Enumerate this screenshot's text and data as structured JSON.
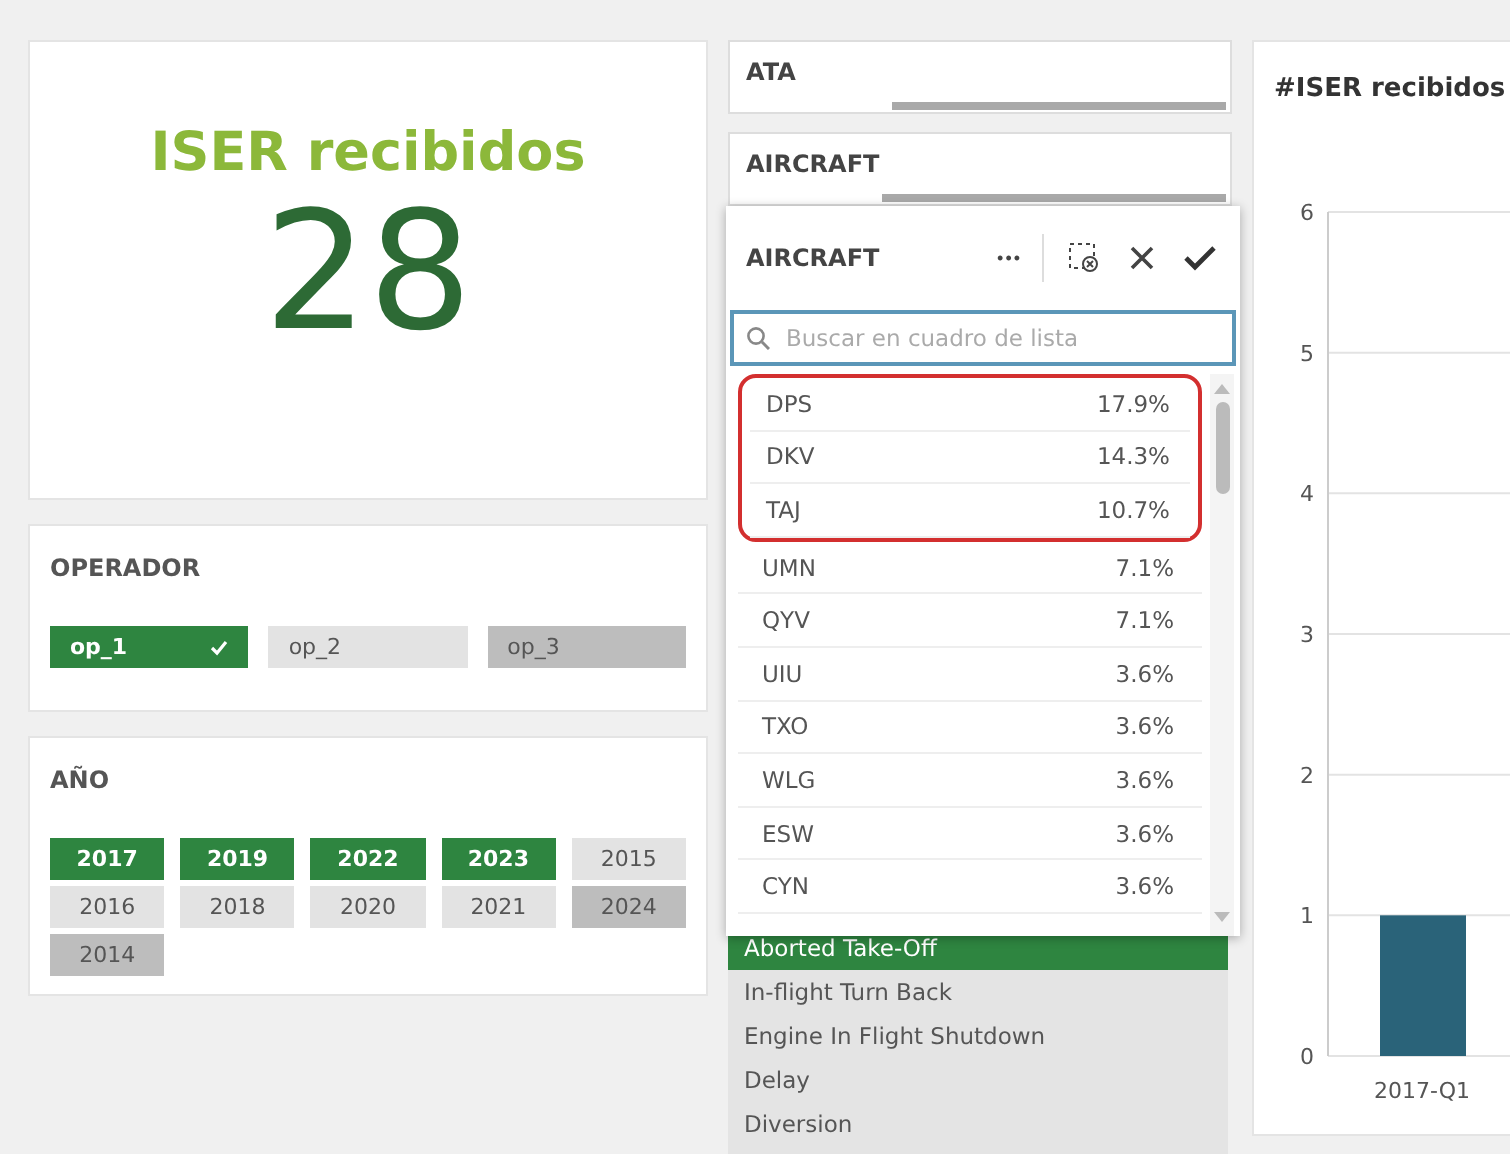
{
  "kpi": {
    "title": "ISER recibidos",
    "value": "28"
  },
  "operador": {
    "title": "OPERADOR",
    "items": [
      {
        "label": "op_1",
        "selected": true,
        "excluded": false
      },
      {
        "label": "op_2",
        "selected": false,
        "excluded": false
      },
      {
        "label": "op_3",
        "selected": false,
        "excluded": true
      }
    ]
  },
  "anio": {
    "title": "AÑO",
    "items": [
      {
        "label": "2017",
        "selected": true,
        "excluded": false
      },
      {
        "label": "2019",
        "selected": true,
        "excluded": false
      },
      {
        "label": "2022",
        "selected": true,
        "excluded": false
      },
      {
        "label": "2023",
        "selected": true,
        "excluded": false
      },
      {
        "label": "2015",
        "selected": false,
        "excluded": false
      },
      {
        "label": "2016",
        "selected": false,
        "excluded": false
      },
      {
        "label": "2018",
        "selected": false,
        "excluded": false
      },
      {
        "label": "2020",
        "selected": false,
        "excluded": false
      },
      {
        "label": "2021",
        "selected": false,
        "excluded": false
      },
      {
        "label": "2024",
        "selected": false,
        "excluded": true
      },
      {
        "label": "2014",
        "selected": false,
        "excluded": true
      }
    ]
  },
  "filters": [
    {
      "label": "ATA",
      "level": 0.32
    },
    {
      "label": "AIRCRAFT",
      "level": 0.3
    }
  ],
  "event_list": {
    "items": [
      {
        "label": "Aborted Take-Off",
        "selected": true
      },
      {
        "label": "In-flight Turn Back",
        "selected": false
      },
      {
        "label": "Engine In Flight Shutdown",
        "selected": false
      },
      {
        "label": "Delay",
        "selected": false
      },
      {
        "label": "Diversion",
        "selected": false
      }
    ]
  },
  "popover": {
    "title": "AIRCRAFT",
    "more": "•••",
    "search": {
      "placeholder": "Buscar en cuadro de lista"
    },
    "highlighted_items": [
      {
        "label": "DPS",
        "value": "17.9%"
      },
      {
        "label": "DKV",
        "value": "14.3%"
      },
      {
        "label": "TAJ",
        "value": "10.7%"
      }
    ],
    "items": [
      {
        "label": "UMN",
        "value": "7.1%"
      },
      {
        "label": "QYV",
        "value": "7.1%"
      },
      {
        "label": "UIU",
        "value": "3.6%"
      },
      {
        "label": "TXO",
        "value": "3.6%"
      },
      {
        "label": "WLG",
        "value": "3.6%"
      },
      {
        "label": "ESW",
        "value": "3.6%"
      },
      {
        "label": "CYN",
        "value": "3.6%"
      }
    ]
  },
  "chart": {
    "title": "#ISER recibidos",
    "chart_data": {
      "type": "bar",
      "categories": [
        "2017-Q1"
      ],
      "values": [
        1
      ],
      "ylim": [
        0,
        6
      ],
      "yticks": [
        0,
        1,
        2,
        3,
        4,
        5,
        6
      ],
      "grid": true
    }
  }
}
